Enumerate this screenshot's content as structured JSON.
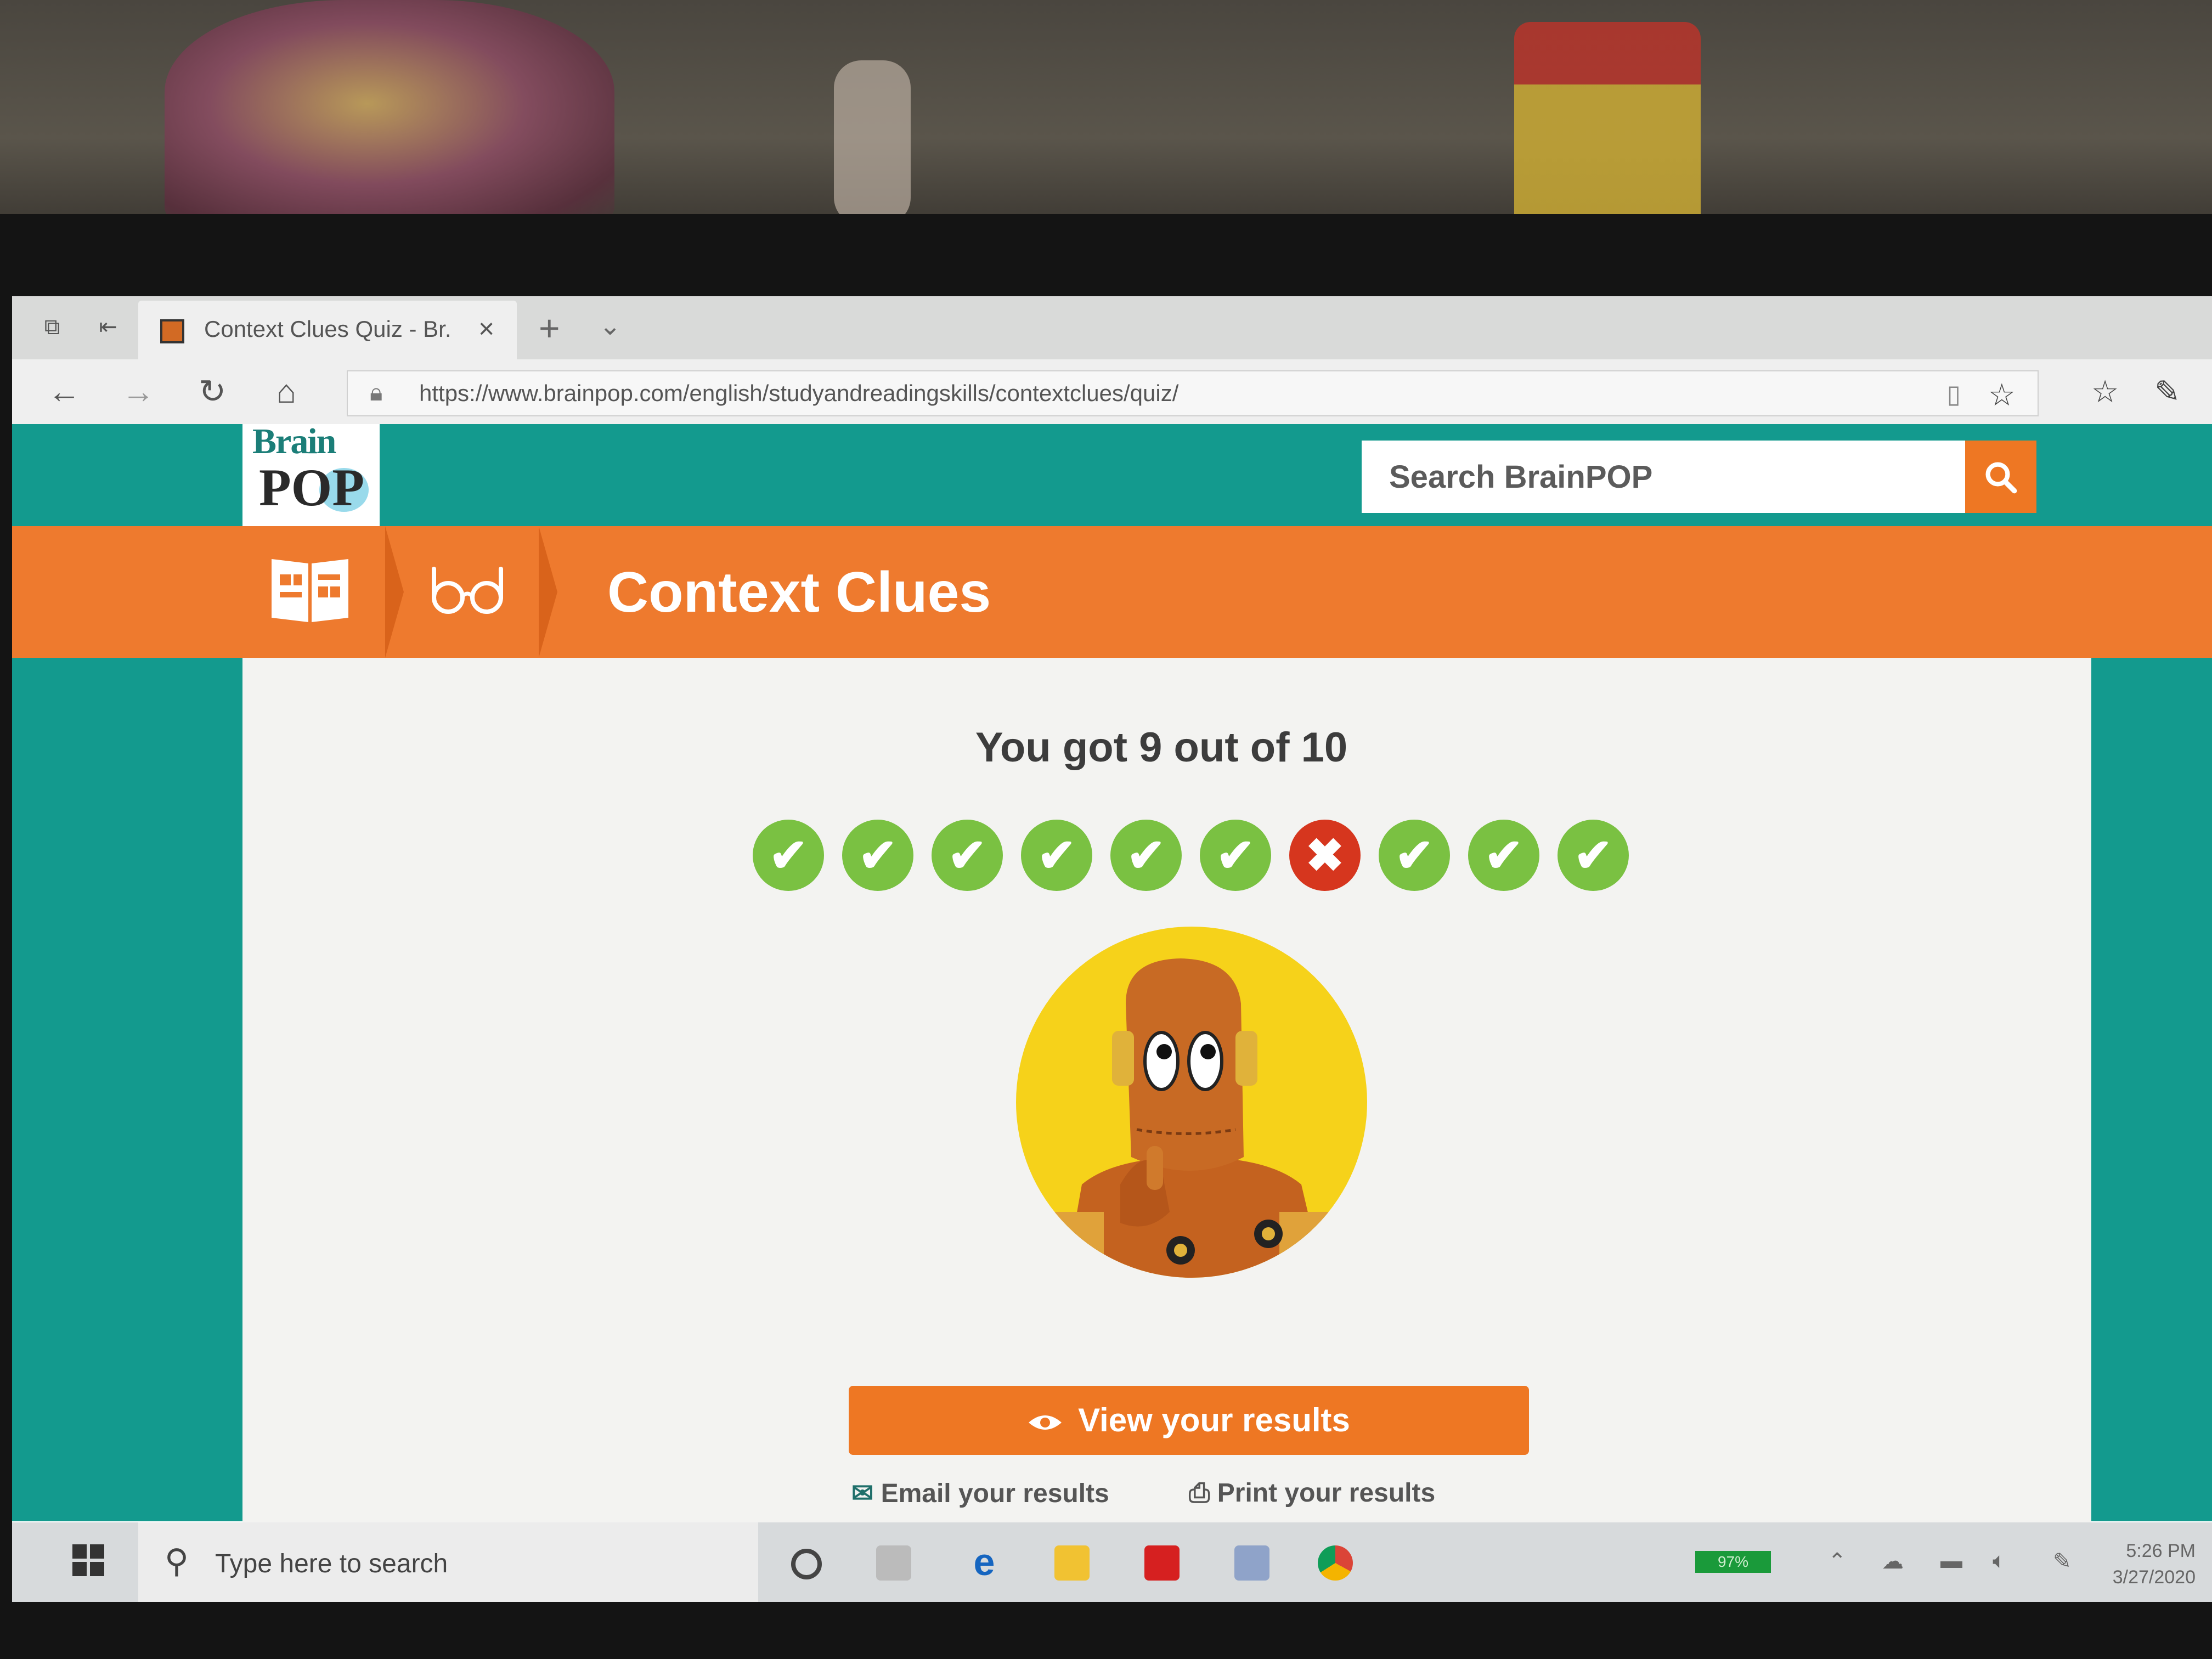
{
  "browser": {
    "tab_title": "Context Clues Quiz - Br.",
    "tab_close": "×",
    "new_tab": "+",
    "tab_menu": "⌄",
    "url": "https://www.brainpop.com/english/studyandreadingskills/contextclues/quiz/",
    "icons": [
      "back-icon",
      "forward-icon",
      "refresh-icon",
      "home-icon",
      "lock-icon",
      "reading-view-icon",
      "favorite-star-icon",
      "favorites-hub-icon",
      "pen-icon"
    ]
  },
  "site": {
    "logo_top": "Brain",
    "logo_bottom": "POP",
    "search_placeholder": "Search BrainPOP",
    "topic_title": "Context Clues",
    "colors": {
      "teal": "#139a8e",
      "orange": "#ee7a2e",
      "correct": "#7ac142",
      "wrong": "#d6361e"
    }
  },
  "quiz": {
    "score_text": "You got 9 out of 10",
    "answers": [
      "correct",
      "correct",
      "correct",
      "correct",
      "correct",
      "correct",
      "wrong",
      "correct",
      "correct",
      "correct"
    ],
    "check_glyph": "✔",
    "wrong_glyph": "✖",
    "view_results": "View your results",
    "email_results": "Email your results",
    "print_results": "Print your results"
  },
  "taskbar": {
    "search_text": "Type here to search",
    "battery": "97%",
    "time": "5:26 PM",
    "date": "3/27/2020"
  }
}
